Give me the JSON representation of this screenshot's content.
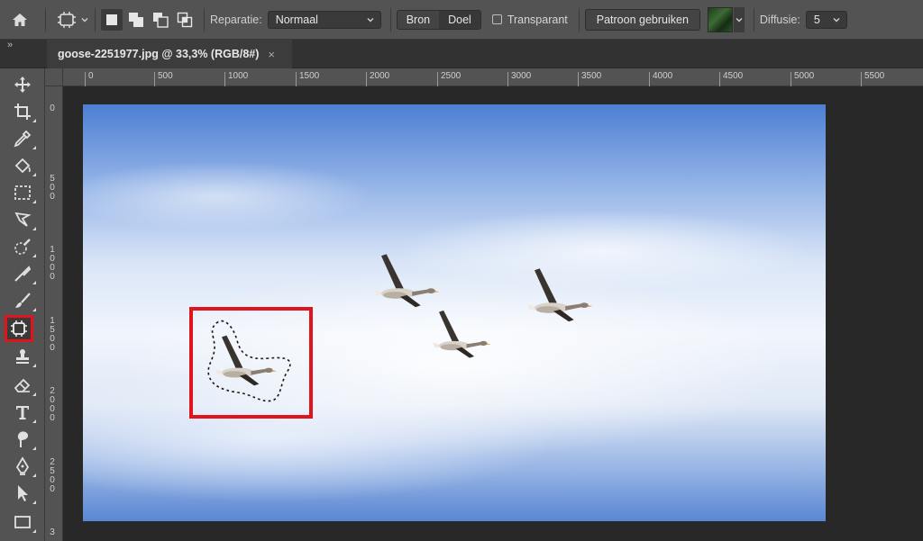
{
  "options_bar": {
    "reparatie_label": "Reparatie:",
    "reparatie_value": "Normaal",
    "bron_label": "Bron",
    "doel_label": "Doel",
    "transparant_label": "Transparant",
    "patroon_button": "Patroon gebruiken",
    "diffusie_label": "Diffusie:",
    "diffusie_value": "5"
  },
  "document_tab": {
    "title": "goose-2251977.jpg @ 33,3% (RGB/8#)",
    "close": "×"
  },
  "panel_collapse": "»",
  "ruler": {
    "horizontal": [
      "0",
      "500",
      "1000",
      "1500",
      "2000",
      "2500",
      "3000",
      "3500",
      "4000",
      "4500",
      "5000",
      "5500"
    ],
    "vertical": [
      "0",
      "500",
      "1000",
      "1500",
      "2000",
      "2500",
      "3"
    ]
  },
  "colors": {
    "highlight": "#e2141b",
    "ui_panel": "#535353",
    "workspace": "#282828"
  },
  "tools": [
    "move-icon",
    "crop-icon",
    "eyedropper-icon",
    "paint-bucket-icon",
    "rect-marquee-icon",
    "lasso-icon",
    "quick-select-icon",
    "spot-healing-icon",
    "brush-icon",
    "patch-icon",
    "clone-stamp-icon",
    "eraser-icon",
    "type-icon",
    "smudge-icon",
    "pen-icon",
    "path-select-icon",
    "rectangle-icon"
  ]
}
